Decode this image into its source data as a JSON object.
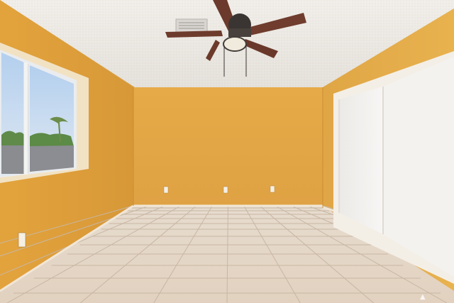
{
  "scene": {
    "description_icon": "empty-room-photo",
    "colors": {
      "wall_left": "#dfa340",
      "wall_back": "#e3a845",
      "wall_right": "#e2a846",
      "ceiling": "#ebe7e1",
      "floor_tile": "#e3d6c7",
      "grout": "#c9b8a6",
      "fan_blade": "#6a3a2c",
      "fan_body": "#3b3633",
      "closet_door": "#f3f1ee",
      "window_sky": "#c4d9ee"
    },
    "watermark_glyph": "▲"
  }
}
